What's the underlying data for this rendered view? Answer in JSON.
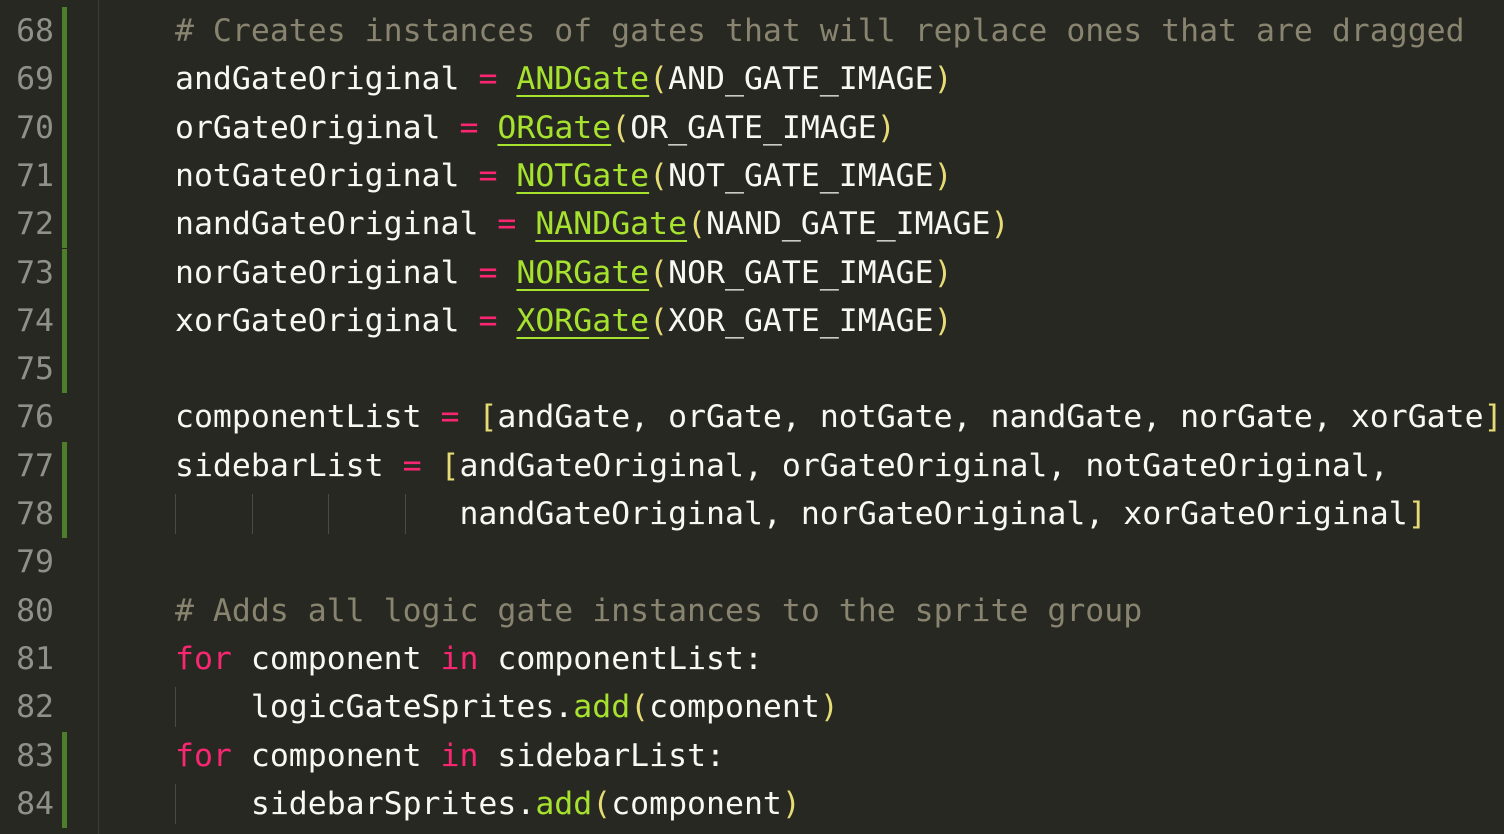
{
  "editor": {
    "colors": {
      "background": "#272822",
      "line_number": "#90908a",
      "git_modified": "#4d7f2b",
      "comment": "#88846f",
      "keyword_operator": "#f92672",
      "class_function": "#a6e22e",
      "bracket": "#e6db74",
      "text": "#f8f8f2"
    },
    "lines": [
      {
        "num": "68",
        "git": true,
        "indent": 0,
        "guides": 0,
        "tokens": [
          {
            "t": "# Creates instances of gates that will replace ones that are dragged",
            "c": "comment"
          }
        ]
      },
      {
        "num": "69",
        "git": true,
        "indent": 0,
        "guides": 0,
        "tokens": [
          {
            "t": "andGateOriginal ",
            "c": "plain"
          },
          {
            "t": "=",
            "c": "op"
          },
          {
            "t": " ",
            "c": "plain"
          },
          {
            "t": "ANDGate",
            "c": "class"
          },
          {
            "t": "(",
            "c": "paren"
          },
          {
            "t": "AND_GATE_IMAGE",
            "c": "plain"
          },
          {
            "t": ")",
            "c": "paren"
          }
        ]
      },
      {
        "num": "70",
        "git": true,
        "indent": 0,
        "guides": 0,
        "tokens": [
          {
            "t": "orGateOriginal ",
            "c": "plain"
          },
          {
            "t": "=",
            "c": "op"
          },
          {
            "t": " ",
            "c": "plain"
          },
          {
            "t": "ORGate",
            "c": "class"
          },
          {
            "t": "(",
            "c": "paren"
          },
          {
            "t": "OR_GATE_IMAGE",
            "c": "plain"
          },
          {
            "t": ")",
            "c": "paren"
          }
        ]
      },
      {
        "num": "71",
        "git": true,
        "indent": 0,
        "guides": 0,
        "tokens": [
          {
            "t": "notGateOriginal ",
            "c": "plain"
          },
          {
            "t": "=",
            "c": "op"
          },
          {
            "t": " ",
            "c": "plain"
          },
          {
            "t": "NOTGate",
            "c": "class"
          },
          {
            "t": "(",
            "c": "paren"
          },
          {
            "t": "NOT_GATE_IMAGE",
            "c": "plain"
          },
          {
            "t": ")",
            "c": "paren"
          }
        ]
      },
      {
        "num": "72",
        "git": true,
        "indent": 0,
        "guides": 0,
        "tokens": [
          {
            "t": "nandGateOriginal ",
            "c": "plain"
          },
          {
            "t": "=",
            "c": "op"
          },
          {
            "t": " ",
            "c": "plain"
          },
          {
            "t": "NANDGate",
            "c": "class"
          },
          {
            "t": "(",
            "c": "paren"
          },
          {
            "t": "NAND_GATE_IMAGE",
            "c": "plain"
          },
          {
            "t": ")",
            "c": "paren"
          }
        ]
      },
      {
        "num": "73",
        "git": true,
        "indent": 0,
        "guides": 0,
        "tokens": [
          {
            "t": "norGateOriginal ",
            "c": "plain"
          },
          {
            "t": "=",
            "c": "op"
          },
          {
            "t": " ",
            "c": "plain"
          },
          {
            "t": "NORGate",
            "c": "class"
          },
          {
            "t": "(",
            "c": "paren"
          },
          {
            "t": "NOR_GATE_IMAGE",
            "c": "plain"
          },
          {
            "t": ")",
            "c": "paren"
          }
        ]
      },
      {
        "num": "74",
        "git": true,
        "indent": 0,
        "guides": 0,
        "tokens": [
          {
            "t": "xorGateOriginal ",
            "c": "plain"
          },
          {
            "t": "=",
            "c": "op"
          },
          {
            "t": " ",
            "c": "plain"
          },
          {
            "t": "XORGate",
            "c": "class"
          },
          {
            "t": "(",
            "c": "paren"
          },
          {
            "t": "XOR_GATE_IMAGE",
            "c": "plain"
          },
          {
            "t": ")",
            "c": "paren"
          }
        ]
      },
      {
        "num": "75",
        "git": true,
        "indent": 0,
        "guides": 0,
        "tokens": []
      },
      {
        "num": "76",
        "git": false,
        "indent": 0,
        "guides": 0,
        "tokens": [
          {
            "t": "componentList ",
            "c": "plain"
          },
          {
            "t": "=",
            "c": "op"
          },
          {
            "t": " ",
            "c": "plain"
          },
          {
            "t": "[",
            "c": "paren"
          },
          {
            "t": "andGate, orGate, notGate, nandGate, norGate, xorGate",
            "c": "plain"
          },
          {
            "t": "]",
            "c": "paren"
          }
        ]
      },
      {
        "num": "77",
        "git": true,
        "indent": 0,
        "guides": 0,
        "tokens": [
          {
            "t": "sidebarList ",
            "c": "plain"
          },
          {
            "t": "=",
            "c": "op"
          },
          {
            "t": " ",
            "c": "plain"
          },
          {
            "t": "[",
            "c": "paren"
          },
          {
            "t": "andGateOriginal, orGateOriginal, notGateOriginal,",
            "c": "plain"
          }
        ]
      },
      {
        "num": "78",
        "git": true,
        "indent": 0,
        "guides": 4,
        "tokens": [
          {
            "t": "               nandGateOriginal, norGateOriginal, xorGateOriginal",
            "c": "plain"
          },
          {
            "t": "]",
            "c": "paren"
          }
        ]
      },
      {
        "num": "79",
        "git": false,
        "indent": 0,
        "guides": 0,
        "tokens": []
      },
      {
        "num": "80",
        "git": false,
        "indent": 0,
        "guides": 0,
        "tokens": [
          {
            "t": "# Adds all logic gate instances to the sprite group",
            "c": "comment"
          }
        ]
      },
      {
        "num": "81",
        "git": false,
        "indent": 0,
        "guides": 0,
        "tokens": [
          {
            "t": "for",
            "c": "kw"
          },
          {
            "t": " component ",
            "c": "plain"
          },
          {
            "t": "in",
            "c": "kw"
          },
          {
            "t": " componentList:",
            "c": "plain"
          }
        ]
      },
      {
        "num": "82",
        "git": false,
        "indent": 0,
        "guides": 1,
        "tokens": [
          {
            "t": "    logicGateSprites.",
            "c": "plain"
          },
          {
            "t": "add",
            "c": "func"
          },
          {
            "t": "(",
            "c": "paren"
          },
          {
            "t": "component",
            "c": "plain"
          },
          {
            "t": ")",
            "c": "paren"
          }
        ]
      },
      {
        "num": "83",
        "git": true,
        "indent": 0,
        "guides": 0,
        "tokens": [
          {
            "t": "for",
            "c": "kw"
          },
          {
            "t": " component ",
            "c": "plain"
          },
          {
            "t": "in",
            "c": "kw"
          },
          {
            "t": " sidebarList:",
            "c": "plain"
          }
        ]
      },
      {
        "num": "84",
        "git": true,
        "indent": 0,
        "guides": 1,
        "tokens": [
          {
            "t": "    sidebarSprites.",
            "c": "plain"
          },
          {
            "t": "add",
            "c": "func"
          },
          {
            "t": "(",
            "c": "paren"
          },
          {
            "t": "component",
            "c": "plain"
          },
          {
            "t": ")",
            "c": "paren"
          }
        ]
      }
    ]
  }
}
